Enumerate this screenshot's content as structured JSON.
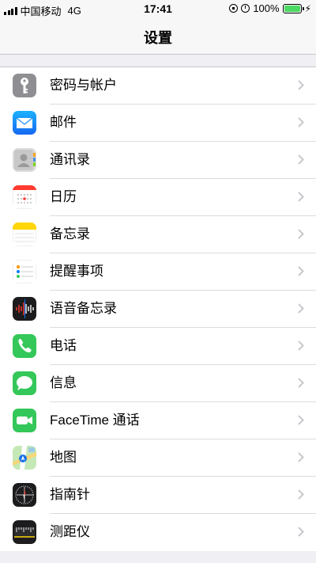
{
  "status_bar": {
    "carrier": "中国移动",
    "network": "4G",
    "time": "17:41",
    "battery": "100%",
    "battery_color": "#4cd964"
  },
  "nav": {
    "title": "设置"
  },
  "settings_items": [
    {
      "label": "密码与帐户",
      "icon": "key-icon",
      "icon_color": "#8e8e93"
    },
    {
      "label": "邮件",
      "icon": "mail-icon",
      "icon_color": "#1e88f5"
    },
    {
      "label": "通讯录",
      "icon": "contacts-icon",
      "icon_color": "#d9d9d9"
    },
    {
      "label": "日历",
      "icon": "calendar-icon",
      "icon_color": "#ffffff"
    },
    {
      "label": "备忘录",
      "icon": "notes-icon",
      "icon_color": "#ffd60a"
    },
    {
      "label": "提醒事项",
      "icon": "reminders-icon",
      "icon_color": "#ffffff"
    },
    {
      "label": "语音备忘录",
      "icon": "voice-memos-icon",
      "icon_color": "#1c1c1e"
    },
    {
      "label": "电话",
      "icon": "phone-icon",
      "icon_color": "#34c759"
    },
    {
      "label": "信息",
      "icon": "messages-icon",
      "icon_color": "#34c759"
    },
    {
      "label": "FaceTime 通话",
      "icon": "facetime-icon",
      "icon_color": "#34c759"
    },
    {
      "label": "地图",
      "icon": "maps-icon",
      "icon_color": "#a5d6a7"
    },
    {
      "label": "指南针",
      "icon": "compass-icon",
      "icon_color": "#1c1c1e"
    },
    {
      "label": "测距仪",
      "icon": "measure-icon",
      "icon_color": "#1c1c1e"
    }
  ]
}
